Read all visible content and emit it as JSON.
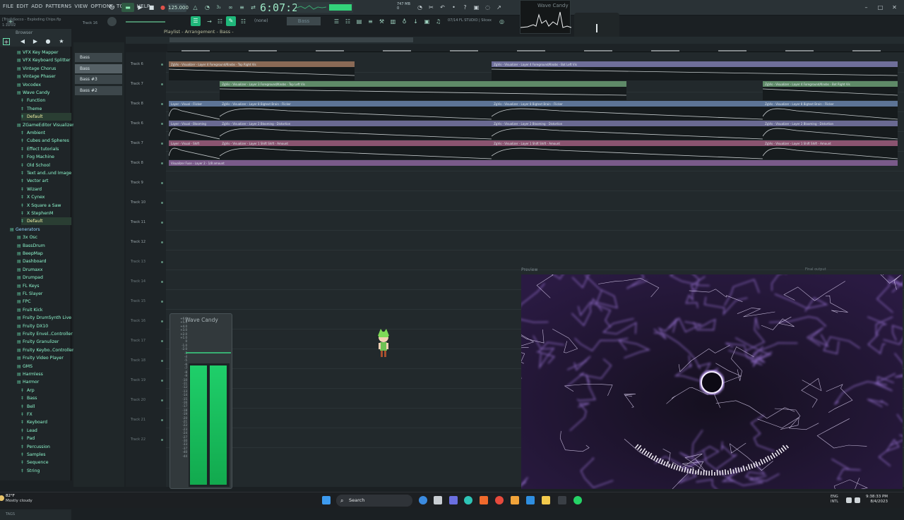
{
  "menu": [
    "FILE",
    "EDIT",
    "ADD",
    "PATTERNS",
    "VIEW",
    "OPTIONS",
    "TOOLS",
    "HELP"
  ],
  "project": {
    "name": "[Trial] Socco - Exploding Chips.flp",
    "time": "1:11:02"
  },
  "transport": {
    "tempo": "125.000",
    "clock": "6:07:21",
    "cpu": "747 MB",
    "cpu2": "0"
  },
  "track_label_top": "Track 16",
  "toolbar2": {
    "none": "(none)",
    "pattern": "Bass",
    "version": "07/14 FL STUDIO | Slicex"
  },
  "wave_candy_top": {
    "title": "Wave Candy"
  },
  "browser": {
    "title": "Browser",
    "items": [
      {
        "label": "VFX Key Mapper",
        "type": "plugin",
        "indent": 1
      },
      {
        "label": "VFX Keyboard Splitter",
        "type": "plugin",
        "indent": 1
      },
      {
        "label": "Vintage Chorus",
        "type": "plugin",
        "indent": 1
      },
      {
        "label": "Vintage Phaser",
        "type": "plugin",
        "indent": 1
      },
      {
        "label": "Vocodex",
        "type": "plugin",
        "indent": 1
      },
      {
        "label": "Wave Candy",
        "type": "plugin",
        "indent": 1
      },
      {
        "label": "Function",
        "type": "preset",
        "indent": 2
      },
      {
        "label": "Theme",
        "type": "preset",
        "indent": 2
      },
      {
        "label": "Default",
        "type": "preset",
        "indent": 2,
        "selected": true
      },
      {
        "label": "ZGameEditor Visualizer",
        "type": "plugin",
        "indent": 1
      },
      {
        "label": "Ambient",
        "type": "preset",
        "indent": 2
      },
      {
        "label": "Cubes and Spheres",
        "type": "preset",
        "indent": 2
      },
      {
        "label": "Effect tutorials",
        "type": "preset",
        "indent": 2
      },
      {
        "label": "Fog Machine",
        "type": "preset",
        "indent": 2
      },
      {
        "label": "Old School",
        "type": "preset",
        "indent": 2
      },
      {
        "label": "Text and..und Image",
        "type": "preset",
        "indent": 2
      },
      {
        "label": "Vector art",
        "type": "preset",
        "indent": 2
      },
      {
        "label": "Wizard",
        "type": "preset",
        "indent": 2
      },
      {
        "label": "X Cynex",
        "type": "preset",
        "indent": 2
      },
      {
        "label": "X Square a Saw",
        "type": "preset",
        "indent": 2
      },
      {
        "label": "X StephenM",
        "type": "preset",
        "indent": 2
      },
      {
        "label": "Default",
        "type": "preset",
        "indent": 2,
        "selected": true
      },
      {
        "label": "Generators",
        "type": "folder",
        "indent": 0
      },
      {
        "label": "3x Osc",
        "type": "plugin",
        "indent": 1
      },
      {
        "label": "BassDrum",
        "type": "plugin",
        "indent": 1
      },
      {
        "label": "BeepMap",
        "type": "plugin",
        "indent": 1
      },
      {
        "label": "Dashboard",
        "type": "plugin",
        "indent": 1
      },
      {
        "label": "Drumaxx",
        "type": "plugin",
        "indent": 1
      },
      {
        "label": "Drumpad",
        "type": "plugin",
        "indent": 1
      },
      {
        "label": "FL Keys",
        "type": "plugin",
        "indent": 1
      },
      {
        "label": "FL Slayer",
        "type": "plugin",
        "indent": 1
      },
      {
        "label": "FPC",
        "type": "plugin",
        "indent": 1
      },
      {
        "label": "Fruit Kick",
        "type": "plugin",
        "indent": 1
      },
      {
        "label": "Fruity DrumSynth Live",
        "type": "plugin",
        "indent": 1
      },
      {
        "label": "Fruity DX10",
        "type": "plugin",
        "indent": 1
      },
      {
        "label": "Fruity Envel..Controller",
        "type": "plugin",
        "indent": 1
      },
      {
        "label": "Fruity Granulizer",
        "type": "plugin",
        "indent": 1
      },
      {
        "label": "Fruity Keybo..Controller",
        "type": "plugin",
        "indent": 1
      },
      {
        "label": "Fruity Video Player",
        "type": "plugin",
        "indent": 1
      },
      {
        "label": "GMS",
        "type": "plugin",
        "indent": 1
      },
      {
        "label": "Harmless",
        "type": "plugin",
        "indent": 1
      },
      {
        "label": "Harmor",
        "type": "plugin",
        "indent": 1
      },
      {
        "label": "Arp",
        "type": "preset",
        "indent": 2
      },
      {
        "label": "Bass",
        "type": "preset",
        "indent": 2
      },
      {
        "label": "Bell",
        "type": "preset",
        "indent": 2
      },
      {
        "label": "FX",
        "type": "preset",
        "indent": 2
      },
      {
        "label": "Keyboard",
        "type": "preset",
        "indent": 2
      },
      {
        "label": "Lead",
        "type": "preset",
        "indent": 2
      },
      {
        "label": "Pad",
        "type": "preset",
        "indent": 2
      },
      {
        "label": "Percussion",
        "type": "preset",
        "indent": 2
      },
      {
        "label": "Samples",
        "type": "preset",
        "indent": 2
      },
      {
        "label": "Sequence",
        "type": "preset",
        "indent": 2
      },
      {
        "label": "String",
        "type": "preset",
        "indent": 2
      }
    ],
    "tags_label": "TAGS"
  },
  "channels": [
    {
      "label": "Bass",
      "active": false
    },
    {
      "label": "Bass",
      "active": true
    },
    {
      "label": "Bass #3",
      "active": false
    },
    {
      "label": "Bass #2",
      "active": false
    }
  ],
  "playlist": {
    "title": "Playlist - Arrangement - Bass -",
    "tracks": [
      "Track 6",
      "Track 7",
      "Track 8",
      "Track 6",
      "Track 7",
      "Track 8",
      "Track 9",
      "Track 10",
      "Track 11",
      "Track 12",
      "Track 13",
      "Track 14",
      "Track 15",
      "Track 16",
      "Track 17",
      "Track 18",
      "Track 19",
      "Track 20",
      "Track 21",
      "Track 22"
    ],
    "clips": [
      {
        "row": 0,
        "start": 0.0,
        "end": 0.255,
        "color": "#8a6a56",
        "label": "ZgVis - Visualizer - Layer 4 Foreground/Knobs - Top Right Vis"
      },
      {
        "row": 0,
        "start": 0.443,
        "end": 1.0,
        "color": "#6f6f9a",
        "label": "ZgVis - Visualizer - Layer 4 Foreground/Knobs - Bot Left Vis"
      },
      {
        "row": 1,
        "start": 0.07,
        "end": 0.628,
        "color": "#5f8a68",
        "label": "ZgVis - Visualizer - Layer 3 Foreground/Knobs - Top Left Vis"
      },
      {
        "row": 1,
        "start": 0.815,
        "end": 1.0,
        "color": "#5f8a68",
        "label": "ZgVis - Visualizer - Layer 4 Foreground/Knobs - Bot Right Vis"
      },
      {
        "row": 2,
        "start": 0.0,
        "end": 0.07,
        "color": "#5d7496",
        "label": "Layer - Visual - Flicker"
      },
      {
        "row": 2,
        "start": 0.07,
        "end": 0.443,
        "color": "#5d7496",
        "label": "ZgVis - Visualizer - Layer 8 Bigtext Brain - Flicker"
      },
      {
        "row": 2,
        "start": 0.443,
        "end": 0.815,
        "color": "#5d7496",
        "label": "ZgVis - Visualizer - Layer 8 Bigtext Brain - Flicker"
      },
      {
        "row": 2,
        "start": 0.815,
        "end": 1.0,
        "color": "#5d7496",
        "label": "ZgVis - Visualizer - Layer 8 Bigtext Brain - Flicker"
      },
      {
        "row": 3,
        "start": 0.0,
        "end": 0.07,
        "color": "#6a6a92",
        "label": "Layer - Visual - Blooming"
      },
      {
        "row": 3,
        "start": 0.07,
        "end": 0.443,
        "color": "#6a6a92",
        "label": "ZgVis - Visualizer - Layer 2 Blooming - Distortion"
      },
      {
        "row": 3,
        "start": 0.443,
        "end": 0.815,
        "color": "#6a6a92",
        "label": "ZgVis - Visualizer - Layer 2 Blooming - Distortion"
      },
      {
        "row": 3,
        "start": 0.815,
        "end": 1.0,
        "color": "#6a6a92",
        "label": "ZgVis - Visualizer - Layer 2 Blooming - Distortion"
      },
      {
        "row": 4,
        "start": 0.0,
        "end": 0.07,
        "color": "#8a5470",
        "label": "Layer - Visual - Shift"
      },
      {
        "row": 4,
        "start": 0.07,
        "end": 0.443,
        "color": "#8a5470",
        "label": "ZgVis - Visualizer - Layer 1 Shift Shift - Amount"
      },
      {
        "row": 4,
        "start": 0.443,
        "end": 0.815,
        "color": "#8a5470",
        "label": "ZgVis - Visualizer - Layer 1 Shift Shift - Amount"
      },
      {
        "row": 4,
        "start": 0.815,
        "end": 1.0,
        "color": "#8a5470",
        "label": "ZgVis - Visualizer - Layer 1 Shift Shift - Amount"
      },
      {
        "row": 5,
        "start": 0.0,
        "end": 1.0,
        "color": "#7a5a8a",
        "label": "Visualizer Fuse - Layer 2 - 1/8 amount"
      }
    ]
  },
  "wave_candy": {
    "title": "Wave Candy",
    "scale": [
      "+6.0",
      "+5.0",
      "+4.0",
      "+3.0",
      "+2.0",
      "+1.0",
      "0",
      "-1.0",
      "-2.0",
      "-3",
      "-4",
      "-5",
      "-6",
      "-7",
      "-8",
      "-9",
      "-10",
      "-11",
      "-12",
      "-13",
      "-14",
      "-15",
      "-16",
      "-17",
      "-18",
      "-19",
      "-20",
      "-21",
      "-22",
      "-23",
      "-24",
      "-27",
      "-30",
      "-33",
      "-37",
      "-40",
      "-44"
    ],
    "level_left": 0.98,
    "level_right": 0.98
  },
  "preview": {
    "title": "Preview",
    "controls": "Final output"
  },
  "taskbar": {
    "temp": "82°F",
    "weather": "Mostly cloudy",
    "search": "Search",
    "lang": "ENG",
    "lang2": "INTL",
    "time": "9:38:33 PM",
    "date": "8/4/2023"
  }
}
